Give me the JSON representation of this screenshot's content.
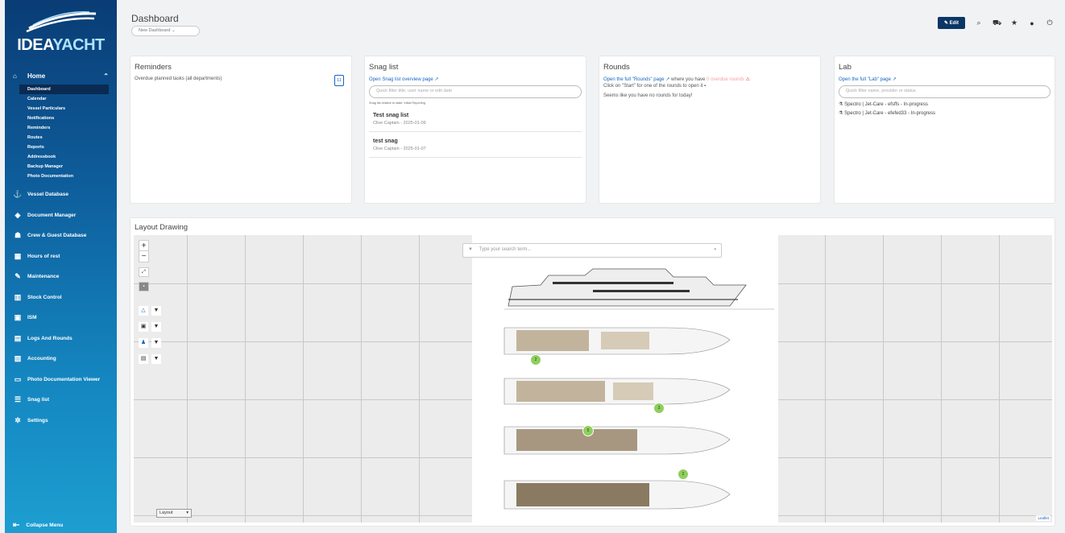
{
  "brand": {
    "logo_prefix": "IDEA",
    "logo_suffix": "YACHT"
  },
  "sidebar": {
    "home": {
      "label": "Home",
      "icon": "home-icon"
    },
    "home_sub": [
      "Dashboard",
      "Calendar",
      "Vessel Particulars",
      "Notifications",
      "Reminders",
      "Routes",
      "Reports",
      "Addressbook",
      "Backup Manager",
      "Photo Documentation"
    ],
    "active_sub": "Dashboard",
    "items": [
      {
        "label": "Vessel Database",
        "icon": "anchor-icon"
      },
      {
        "label": "Document Manager",
        "icon": "document-icon"
      },
      {
        "label": "Crew & Guest Database",
        "icon": "people-icon"
      },
      {
        "label": "Hours of rest",
        "icon": "calendar-icon"
      },
      {
        "label": "Maintenance",
        "icon": "wrench-icon"
      },
      {
        "label": "Stock Control",
        "icon": "barcode-icon"
      },
      {
        "label": "ISM",
        "icon": "clipboard-icon"
      },
      {
        "label": "Logs And Rounds",
        "icon": "logbook-icon"
      },
      {
        "label": "Accounting",
        "icon": "accounting-icon"
      },
      {
        "label": "Photo Documentation Viewer",
        "icon": "photo-icon"
      },
      {
        "label": "Snag list",
        "icon": "list-icon"
      },
      {
        "label": "Settings",
        "icon": "gear-icon"
      }
    ],
    "collapse_label": "Collapse Menu"
  },
  "header": {
    "title": "Dashboard",
    "dashboard_select": "New Dashboard",
    "edit_label": "Edit"
  },
  "reminders": {
    "title": "Reminders",
    "text": "Overdue planned tasks (all departments)",
    "count": "11"
  },
  "snag": {
    "title": "Snag list",
    "link": "Open Snag list overview page",
    "placeholder": "Quick filter title, user name or edit date",
    "caption": "Snag list relative to state: Initial Reporting",
    "items": [
      {
        "title": "Test snag list",
        "meta": "Clive Captain - 2025-01-09"
      },
      {
        "title": "test snag",
        "meta": "Clive Captain - 2025-01-07"
      }
    ]
  },
  "rounds": {
    "title": "Rounds",
    "line1_a": "Open the full \"Rounds\" page",
    "line1_b": "where you have",
    "line1_c": "0 overdue rounds",
    "line2": "Click on \"Start\" for one of the rounds to open it",
    "line3": "Seems like you have no rounds for today!"
  },
  "lab": {
    "title": "Lab",
    "link": "Open the full \"Lab\" page",
    "placeholder": "Quick filter name, provider or status",
    "rows": [
      "Spectro | Jet-Care - efsffs - In-progress",
      "Spectro | Jet-Care - efefed33 - In-progress"
    ]
  },
  "layout": {
    "title": "Layout Drawing",
    "search_placeholder": "Type your search term...",
    "layer_select": "Layout",
    "attribution": "Leaflet",
    "markers": [
      "2",
      "3",
      "5",
      "2"
    ]
  }
}
